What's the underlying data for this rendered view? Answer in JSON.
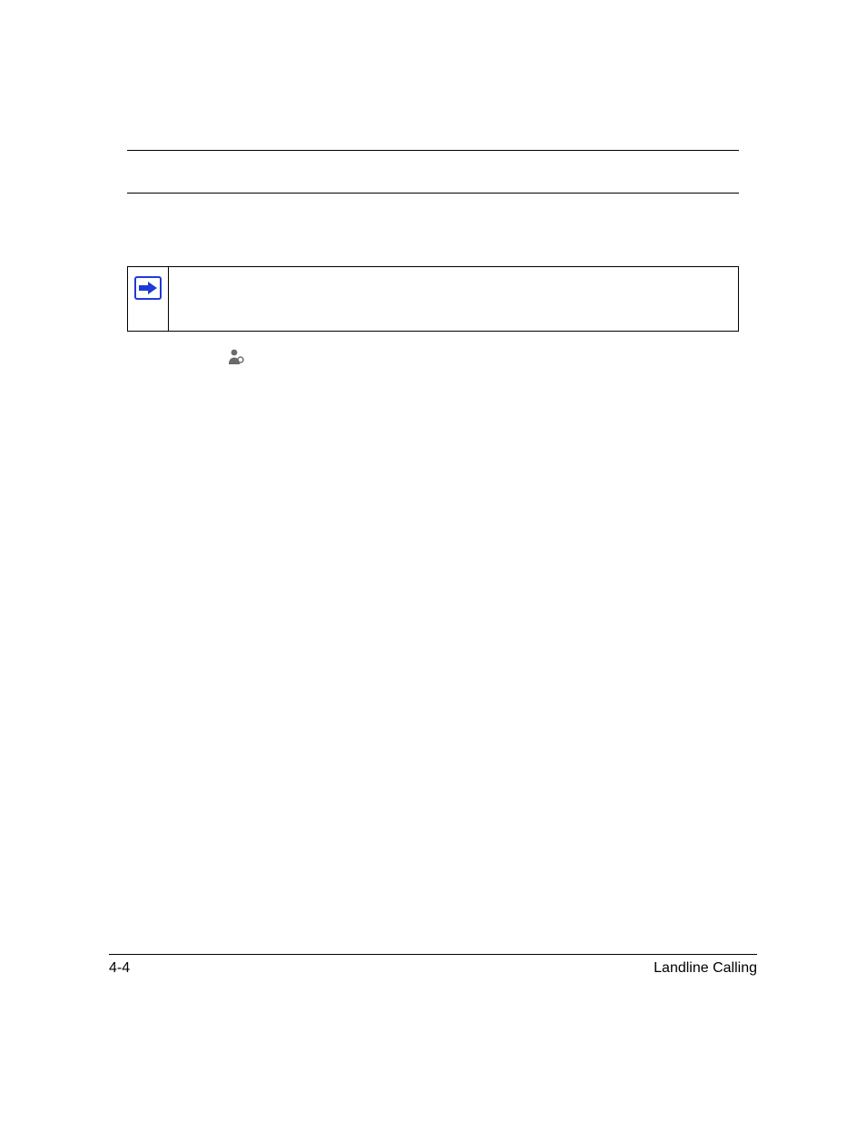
{
  "note": {
    "icon_name": "arrow-right-icon",
    "text": ""
  },
  "inline_icon": {
    "name": "person-setting-icon"
  },
  "footer": {
    "page_number": "4-4",
    "section_title": "Landline Calling"
  }
}
